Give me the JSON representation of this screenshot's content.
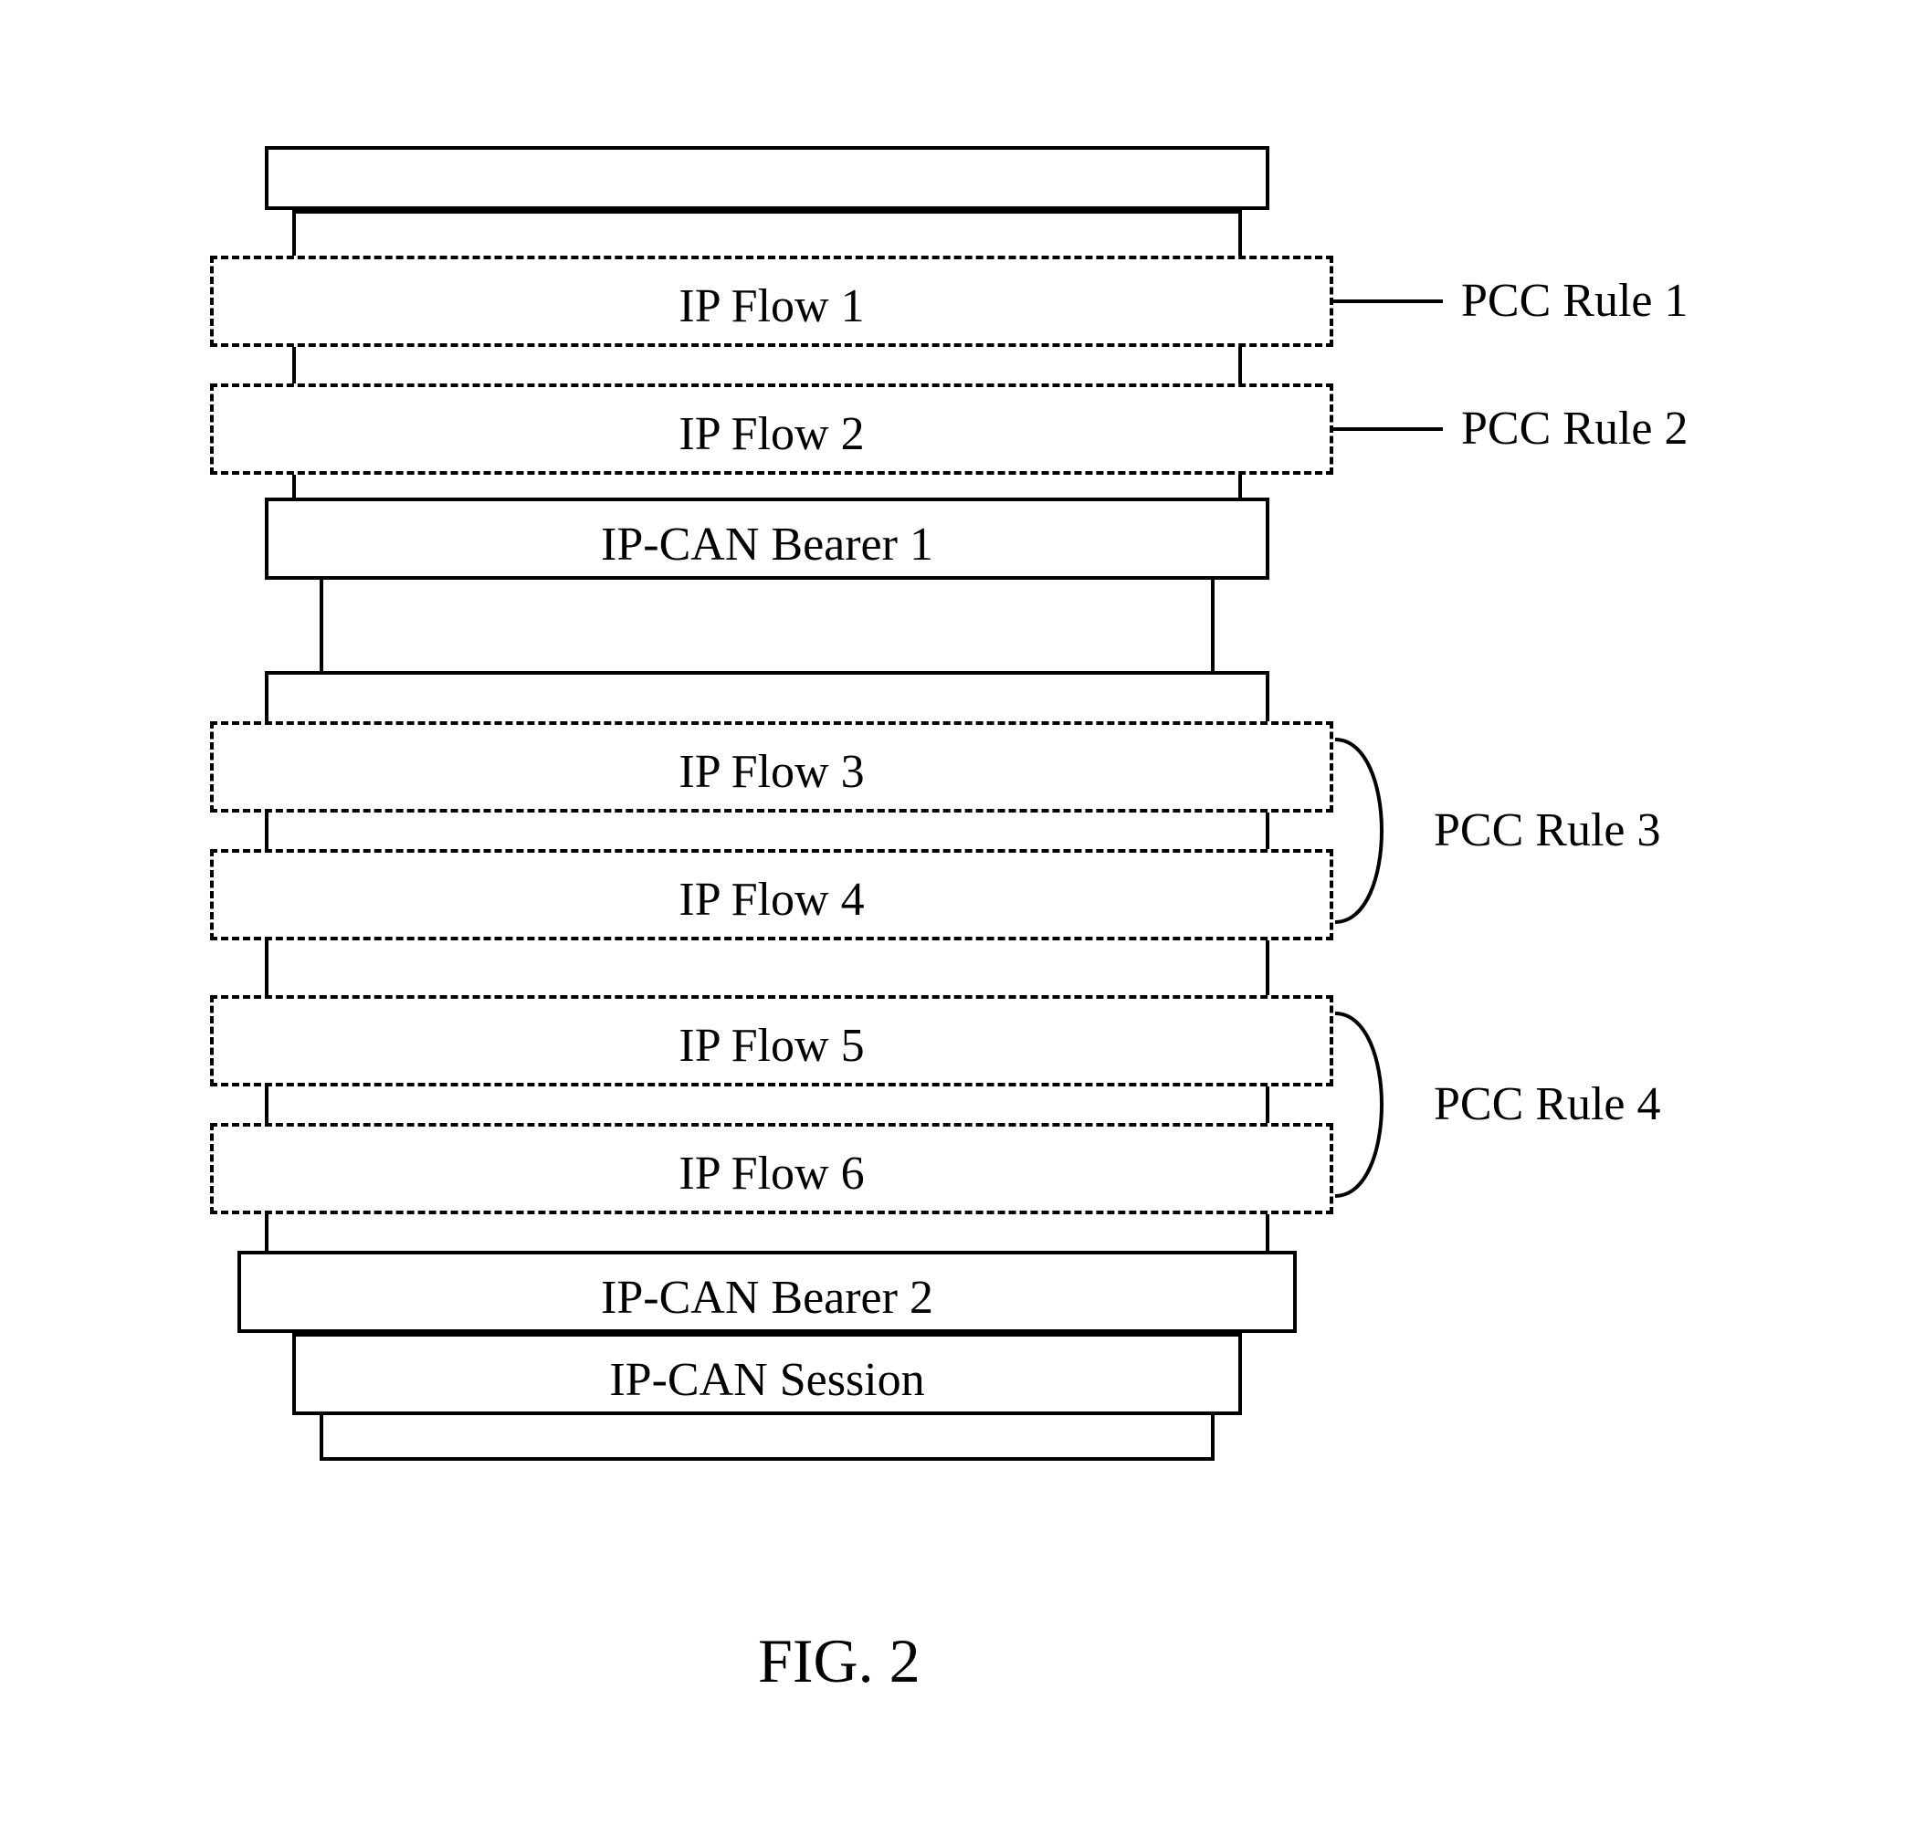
{
  "figure_label": "FIG. 2",
  "session": {
    "label": "IP-CAN Session"
  },
  "bearers": [
    {
      "label": "IP-CAN Bearer 1",
      "flows": [
        {
          "label": "IP Flow 1",
          "rule": "PCC Rule 1"
        },
        {
          "label": "IP Flow 2",
          "rule": "PCC Rule 2"
        }
      ]
    },
    {
      "label": "IP-CAN Bearer 2",
      "flows": [
        {
          "label": "IP Flow 3",
          "rule_group": "PCC Rule 3"
        },
        {
          "label": "IP Flow 4",
          "rule_group": "PCC Rule 3"
        },
        {
          "label": "IP Flow 5",
          "rule_group": "PCC Rule 4"
        },
        {
          "label": "IP Flow 6",
          "rule_group": "PCC Rule 4"
        }
      ],
      "rules": [
        {
          "label": "PCC Rule 3"
        },
        {
          "label": "PCC Rule 4"
        }
      ]
    }
  ]
}
